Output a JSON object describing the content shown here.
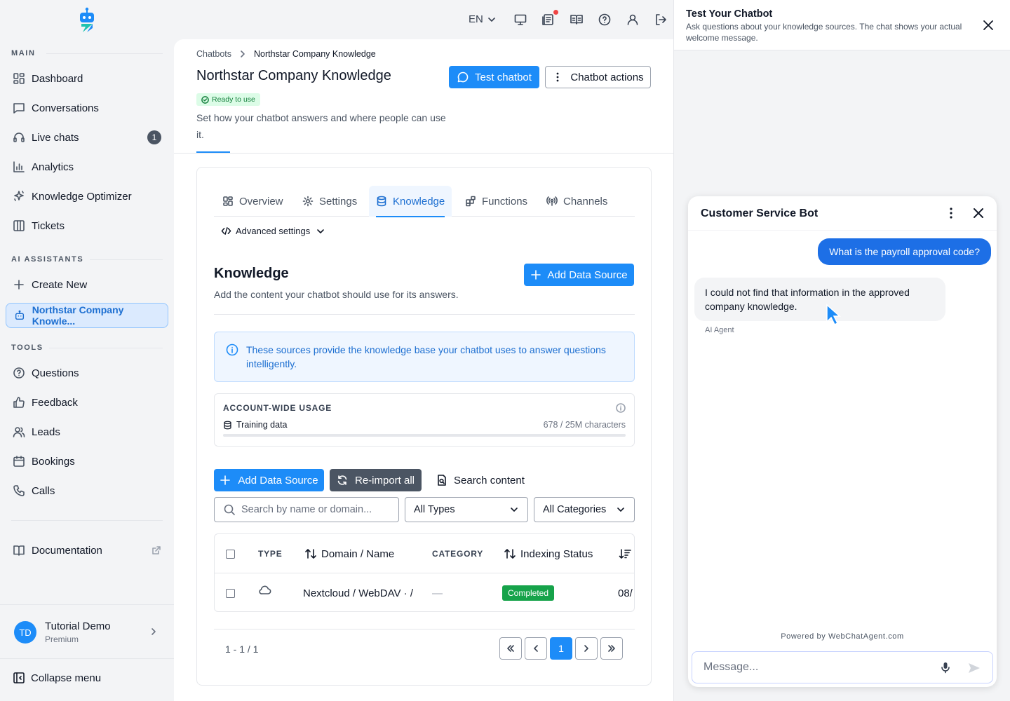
{
  "sidebar": {
    "sections": {
      "main": "MAIN",
      "ai": "AI ASSISTANTS",
      "tools": "TOOLS"
    },
    "main_items": [
      {
        "label": "Dashboard",
        "icon": "dashboard-icon"
      },
      {
        "label": "Conversations",
        "icon": "chat-icon"
      },
      {
        "label": "Live chats",
        "icon": "headset-icon",
        "badge": "1"
      },
      {
        "label": "Analytics",
        "icon": "bar-chart-icon"
      },
      {
        "label": "Knowledge Optimizer",
        "icon": "sparkle-icon"
      },
      {
        "label": "Tickets",
        "icon": "columns-icon"
      }
    ],
    "ai_items": [
      {
        "label": "Create New",
        "icon": "plus-icon"
      },
      {
        "label": "Northstar Company Knowle...",
        "icon": "bot-icon",
        "active": true
      }
    ],
    "tool_items": [
      {
        "label": "Questions",
        "icon": "question-icon"
      },
      {
        "label": "Feedback",
        "icon": "thumbs-up-icon"
      },
      {
        "label": "Leads",
        "icon": "users-icon"
      },
      {
        "label": "Bookings",
        "icon": "calendar-icon"
      },
      {
        "label": "Calls",
        "icon": "phone-icon"
      }
    ],
    "documentation": "Documentation",
    "user": {
      "initials": "TD",
      "name": "Tutorial Demo",
      "plan": "Premium"
    },
    "collapse": "Collapse menu"
  },
  "topbar": {
    "language": "EN"
  },
  "page": {
    "breadcrumb": {
      "root": "Chatbots",
      "current": "Northstar Company Knowledge"
    },
    "title": "Northstar Company Knowledge",
    "status": "Ready to use",
    "description": "Set how your chatbot answers and where people can use it.",
    "test_button": "Test chatbot",
    "actions_button": "Chatbot actions"
  },
  "tabs": [
    {
      "label": "Overview",
      "icon": "grid-icon"
    },
    {
      "label": "Settings",
      "icon": "gear-icon"
    },
    {
      "label": "Knowledge",
      "icon": "database-icon",
      "active": true
    },
    {
      "label": "Functions",
      "icon": "blocks-icon"
    },
    {
      "label": "Channels",
      "icon": "broadcast-icon"
    }
  ],
  "advanced_settings": "Advanced settings",
  "knowledge": {
    "title": "Knowledge",
    "subtitle": "Add the content your chatbot should use for its answers.",
    "add_button": "Add Data Source",
    "info": "These sources provide the knowledge base your chatbot uses to answer questions intelligently.",
    "usage": {
      "title": "ACCOUNT-WIDE USAGE",
      "label": "Training data",
      "count": "678 / 25M characters",
      "fraction": 3e-05
    },
    "actions": {
      "add": "Add Data Source",
      "reimport": "Re-import all",
      "search_content": "Search content"
    },
    "filters": {
      "search_placeholder": "Search by name or domain...",
      "type": "All Types",
      "category": "All Categories"
    },
    "table": {
      "headers": {
        "type": "TYPE",
        "name": "Domain / Name",
        "category": "CATEGORY",
        "status": "Indexing Status"
      },
      "rows": [
        {
          "type_icon": "cloud-icon",
          "name": "Nextcloud / WebDAV · /",
          "category": "—",
          "status": "Completed",
          "date": "08/"
        }
      ]
    },
    "pagination": {
      "range": "1 - 1 / 1",
      "current": "1"
    }
  },
  "panel": {
    "title": "Test Your Chatbot",
    "subtitle": "Ask questions about your knowledge sources. The chat shows your actual welcome message.",
    "bot_name": "Customer Service Bot",
    "user_message": "What is the payroll approval code?",
    "bot_message": "I could not find that information in the approved company knowledge.",
    "bot_author": "AI Agent",
    "powered_by": "Powered by WebChatAgent.com",
    "input_placeholder": "Message..."
  },
  "colors": {
    "accent": "#1d8cf8",
    "success": "#16a34a",
    "danger": "#ef4444"
  }
}
